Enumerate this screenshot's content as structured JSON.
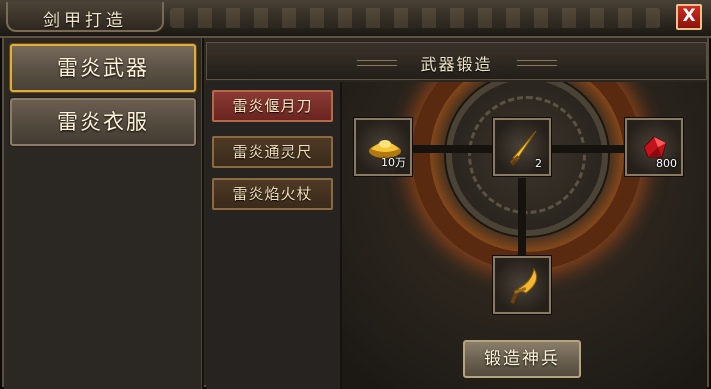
{
  "window": {
    "title": "剑甲打造",
    "close_glyph": "X"
  },
  "categories": [
    {
      "label": "雷炎武器",
      "active": true
    },
    {
      "label": "雷炎衣服",
      "active": false
    }
  ],
  "subitems": [
    {
      "label": "雷炎偃月刀",
      "active": true
    },
    {
      "label": "雷炎通灵尺",
      "active": false
    },
    {
      "label": "雷炎焰火杖",
      "active": false
    }
  ],
  "panel": {
    "title": "武器锻造"
  },
  "forge": {
    "materials": [
      {
        "icon": "gold-ingot-icon",
        "count": "10万"
      },
      {
        "icon": "golden-sword-icon",
        "count": "2"
      },
      {
        "icon": "red-gem-icon",
        "count": "800"
      }
    ],
    "result": {
      "icon": "golden-blade-icon"
    },
    "button_label": "锻造神兵"
  }
}
